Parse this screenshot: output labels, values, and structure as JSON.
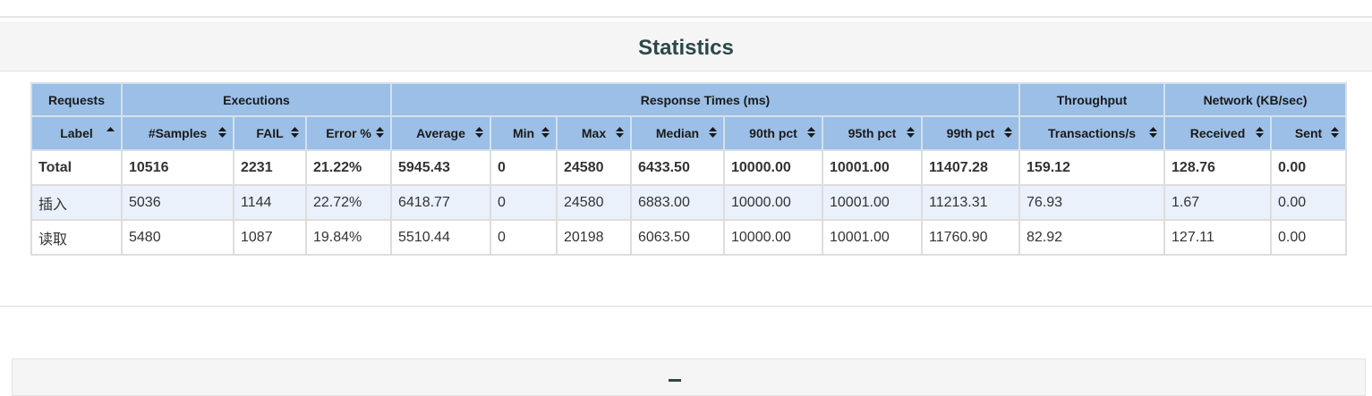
{
  "statistics": {
    "title": "Statistics",
    "group_headers": [
      "Requests",
      "Executions",
      "Response Times (ms)",
      "Throughput",
      "Network (KB/sec)"
    ],
    "columns": [
      {
        "label": "Label",
        "sort": "asc"
      },
      {
        "label": "#Samples",
        "sort": "both"
      },
      {
        "label": "FAIL",
        "sort": "both"
      },
      {
        "label": "Error %",
        "sort": "both"
      },
      {
        "label": "Average",
        "sort": "both"
      },
      {
        "label": "Min",
        "sort": "both"
      },
      {
        "label": "Max",
        "sort": "both"
      },
      {
        "label": "Median",
        "sort": "both"
      },
      {
        "label": "90th pct",
        "sort": "both"
      },
      {
        "label": "95th pct",
        "sort": "both"
      },
      {
        "label": "99th pct",
        "sort": "both"
      },
      {
        "label": "Transactions/s",
        "sort": "both"
      },
      {
        "label": "Received",
        "sort": "both"
      },
      {
        "label": "Sent",
        "sort": "both"
      }
    ],
    "total": [
      "Total",
      "10516",
      "2231",
      "21.22%",
      "5945.43",
      "0",
      "24580",
      "6433.50",
      "10000.00",
      "10001.00",
      "11407.28",
      "159.12",
      "128.76",
      "0.00"
    ],
    "rows": [
      [
        "插入",
        "5036",
        "1144",
        "22.72%",
        "6418.77",
        "0",
        "24580",
        "6883.00",
        "10000.00",
        "10001.00",
        "11213.31",
        "76.93",
        "1.67",
        "0.00"
      ],
      [
        "读取",
        "5480",
        "1087",
        "19.84%",
        "5510.44",
        "0",
        "20198",
        "6063.50",
        "10000.00",
        "10001.00",
        "11760.90",
        "82.92",
        "127.11",
        "0.00"
      ]
    ]
  },
  "colors": {
    "header_bg": "#9bbfe6",
    "title": "#2c4848",
    "row_alt": "#eaf1fa"
  },
  "icons": {
    "sort_asc": "sort-asc-icon",
    "sort_both": "sort-both-icon"
  }
}
